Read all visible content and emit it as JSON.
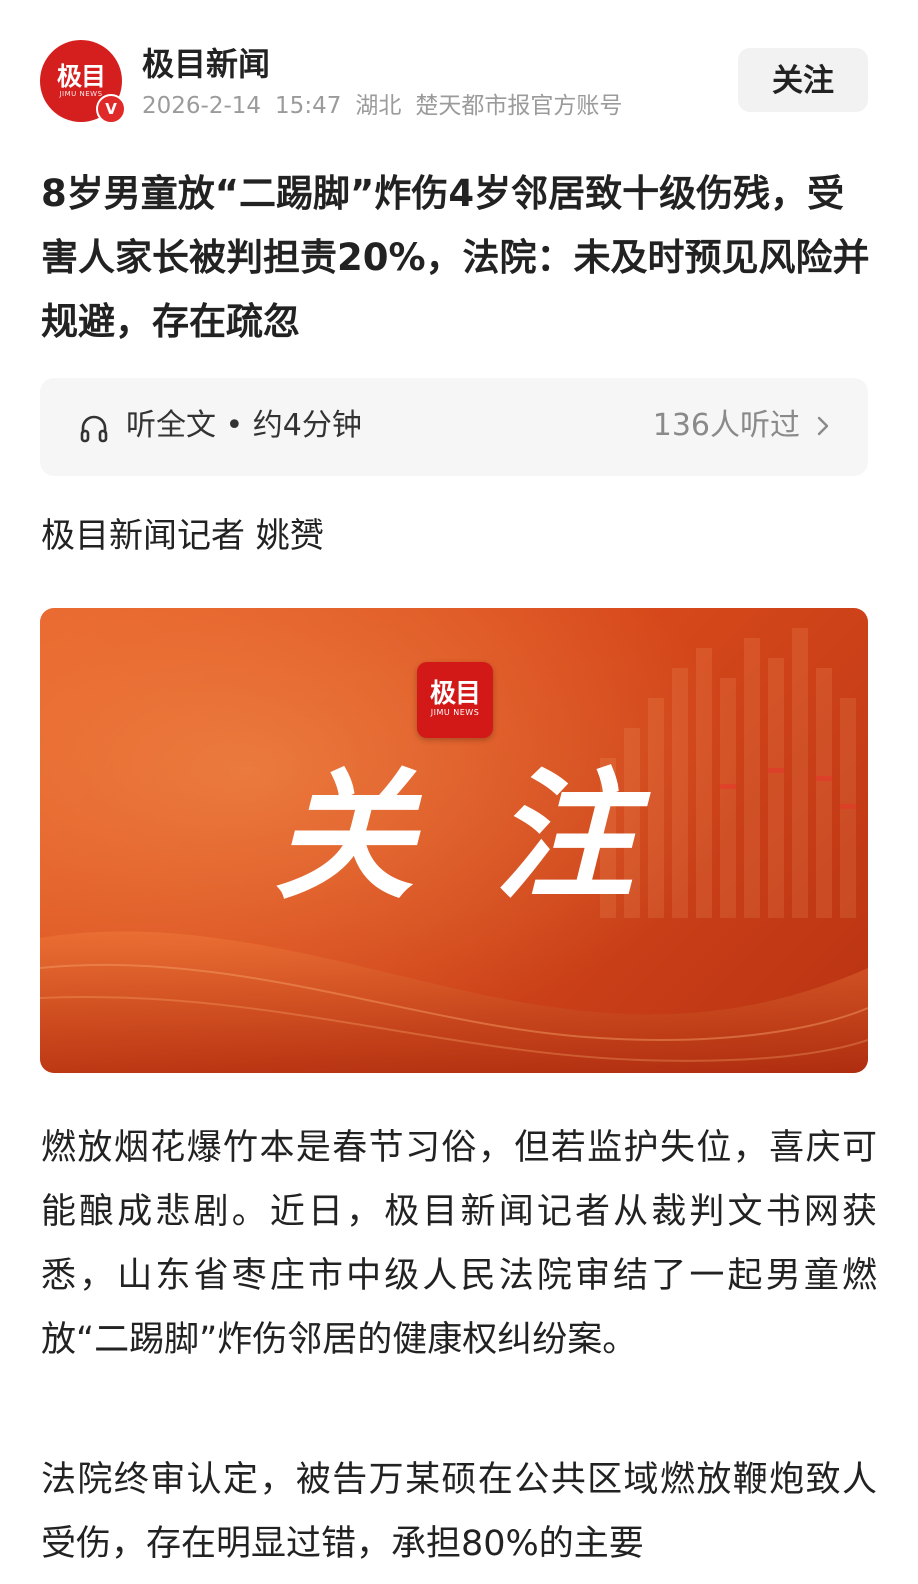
{
  "header": {
    "account_name": "极目新闻",
    "avatar_logo_text": "极目",
    "avatar_logo_sub": "JIMU NEWS",
    "verified_mark": "V",
    "date": "2026-2-14",
    "time": "15:47",
    "location": "湖北",
    "source": "楚天都市报官方账号",
    "follow_label": "关注"
  },
  "article": {
    "title": "8岁男童放“二踢脚”炸伤4岁邻居致十级伤残，受害人家长被判担责20%，法院：未及时预见风险并规避，存在疏忽",
    "audio": {
      "icon": "headphone-icon",
      "label": "听全文 • 约4分钟",
      "count": "136人听过"
    },
    "byline": "极目新闻记者 姚赟",
    "banner": {
      "badge_main": "极目",
      "badge_sub": "JIMU NEWS",
      "headline": "关注"
    },
    "paragraphs": [
      "燃放烟花爆竹本是春节习俗，但若监护失位，喜庆可能酿成悲剧。近日，极目新闻记者从裁判文书网获悉，山东省枣庄市中级人民法院审结了一起男童燃放“二踢脚”炸伤邻居的健康权纠纷案。",
      "法院终审认定，被告万某硕在公共区域燃放鞭炮致人受伤，存在明显过错，承担80%的主要"
    ]
  },
  "colors": {
    "brand_red": "#d51f1f",
    "banner_orange": "#d84a1c",
    "meta_gray": "#9b9b9b"
  }
}
